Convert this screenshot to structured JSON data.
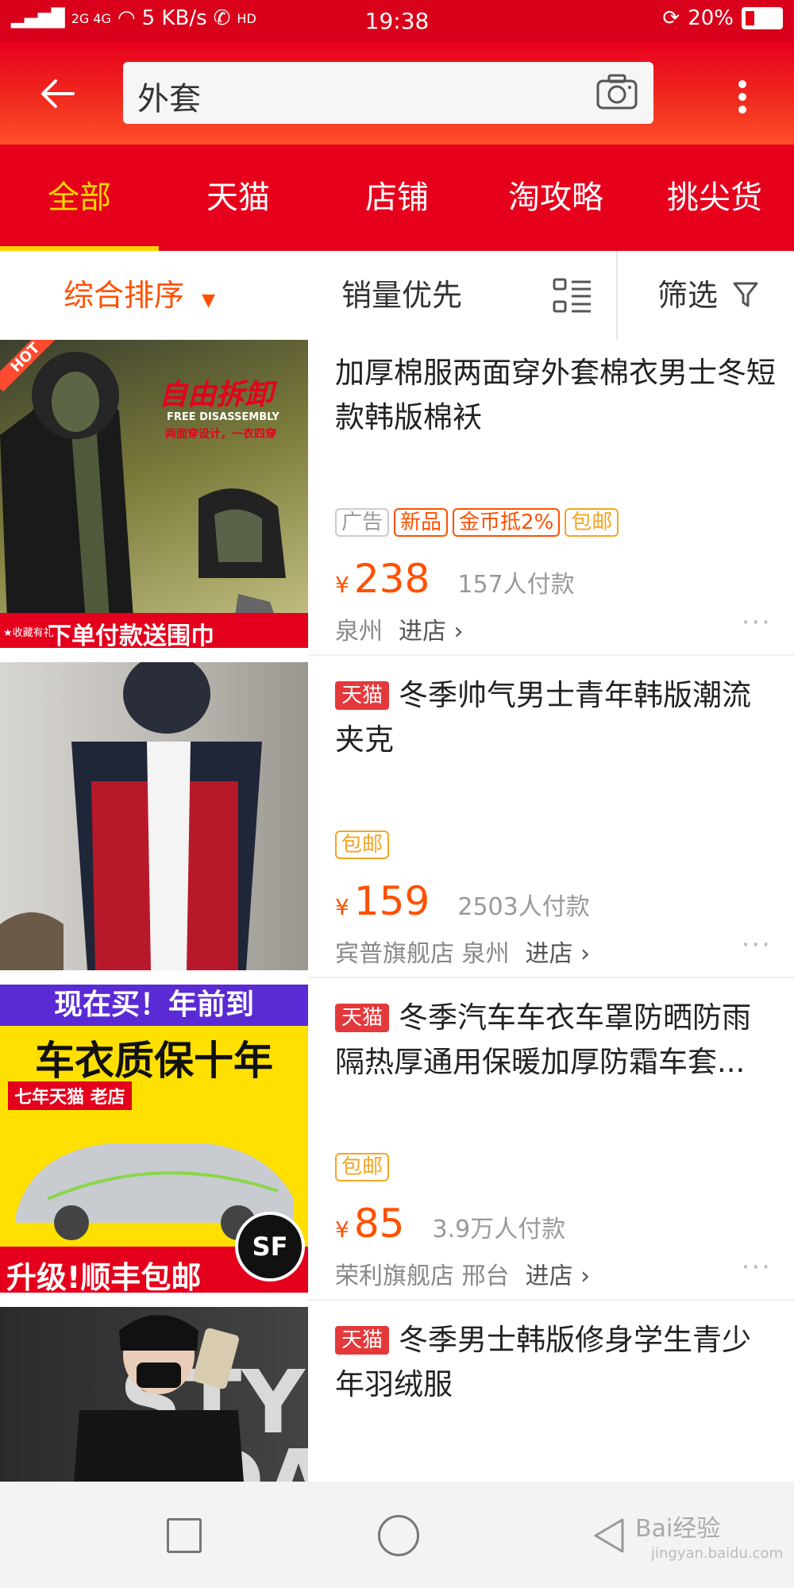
{
  "status_bar": {
    "network": "2G 4G",
    "speed": "5 KB/s",
    "hd": "HD",
    "time": "19:38",
    "battery": "20%",
    "battery_level": 0.2
  },
  "search": {
    "query": "外套"
  },
  "tabs": [
    {
      "label": "全部",
      "active": true
    },
    {
      "label": "天猫"
    },
    {
      "label": "店铺"
    },
    {
      "label": "淘攻略"
    },
    {
      "label": "挑尖货"
    }
  ],
  "sort": {
    "default": "综合排序",
    "sales": "销量优先",
    "filter": "筛选"
  },
  "products": [
    {
      "title": "加厚棉服两面穿外套棉衣男士冬短款韩版棉袄",
      "tags": [
        "广告",
        "新品",
        "金币抵2%",
        "包邮"
      ],
      "currency": "¥",
      "price": "238",
      "paid": "157人付款",
      "shop": "泉州",
      "enter": "进店 ›",
      "image_text": {
        "hot": "HOT",
        "headline": "自由拆卸",
        "sub": "FREE DISASSEMBLY",
        "sub2": "两面穿设计，一衣四穿",
        "footer": "下单付款送围巾",
        "footer_small": "★收藏有礼"
      }
    },
    {
      "tmall": "天猫",
      "title": "冬季帅气男士青年韩版潮流夹克",
      "tags": [
        "包邮"
      ],
      "currency": "¥",
      "price": "159",
      "paid": "2503人付款",
      "shop": "宾普旗舰店 泉州",
      "enter": "进店 ›"
    },
    {
      "tmall": "天猫",
      "title": "冬季汽车车衣车罩防晒防雨隔热厚通用保暖加厚防霜车套...",
      "tags": [
        "包邮"
      ],
      "currency": "¥",
      "price": "85",
      "paid": "3.9万人付款",
      "shop": "荣利旗舰店 邢台",
      "enter": "进店 ›",
      "image_text": {
        "line1": "现在买！年前到",
        "line2": "车衣质保十年",
        "line3": "七年天猫 老店",
        "footer": "升级!顺丰包邮",
        "logo": "SF"
      }
    },
    {
      "tmall": "天猫",
      "title": "冬季男士韩版修身学生青少年羽绒服",
      "image_text": {
        "bg": "STYLE NDA"
      }
    }
  ],
  "watermark": {
    "brand": "Bai经验",
    "url": "jingyan.baidu.com"
  }
}
